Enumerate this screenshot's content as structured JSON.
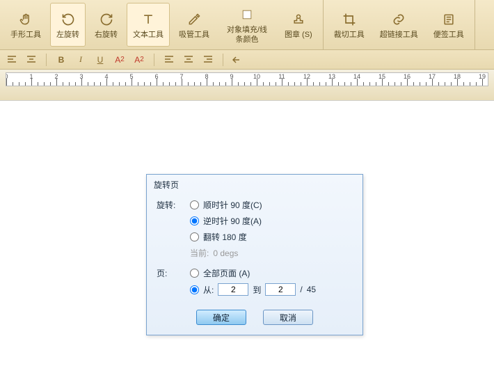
{
  "ribbon": {
    "tools": [
      {
        "label": "手形工具",
        "icon": "hand"
      },
      {
        "label": "左旋转",
        "icon": "rotate-ccw",
        "active": true
      },
      {
        "label": "右旋转",
        "icon": "rotate-cw"
      },
      {
        "label": "文本工具",
        "icon": "text",
        "active": true
      },
      {
        "label": "吸管工具",
        "icon": "eyedropper"
      },
      {
        "label": "对象填充/线条颜色",
        "icon": "fill-color"
      },
      {
        "label": "图章 (S)",
        "icon": "stamp"
      },
      {
        "label": "裁切工具",
        "icon": "crop"
      },
      {
        "label": "超链接工具",
        "icon": "link"
      },
      {
        "label": "便签工具",
        "icon": "note"
      }
    ]
  },
  "subbar": {
    "bold": "B",
    "italic": "I",
    "underline": "U",
    "superscript": "A",
    "superscript_sup": "2",
    "subscript": "A",
    "subscript_sub": "2"
  },
  "ruler": {
    "count": 20
  },
  "dialog": {
    "title": "旋转页",
    "rotate_label": "旋转:",
    "opt_cw": "顺时针 90 度(C)",
    "opt_ccw": "逆时针 90 度(A)",
    "opt_flip": "翻转 180 度",
    "current_label": "当前:",
    "current_value": "0 degs",
    "page_label": "页:",
    "opt_all": "全部页面 (A)",
    "opt_from": "从:",
    "from_value": "2",
    "to_label": "到",
    "to_value": "2",
    "slash": "/",
    "total": "45",
    "ok": "确定",
    "cancel": "取消"
  }
}
